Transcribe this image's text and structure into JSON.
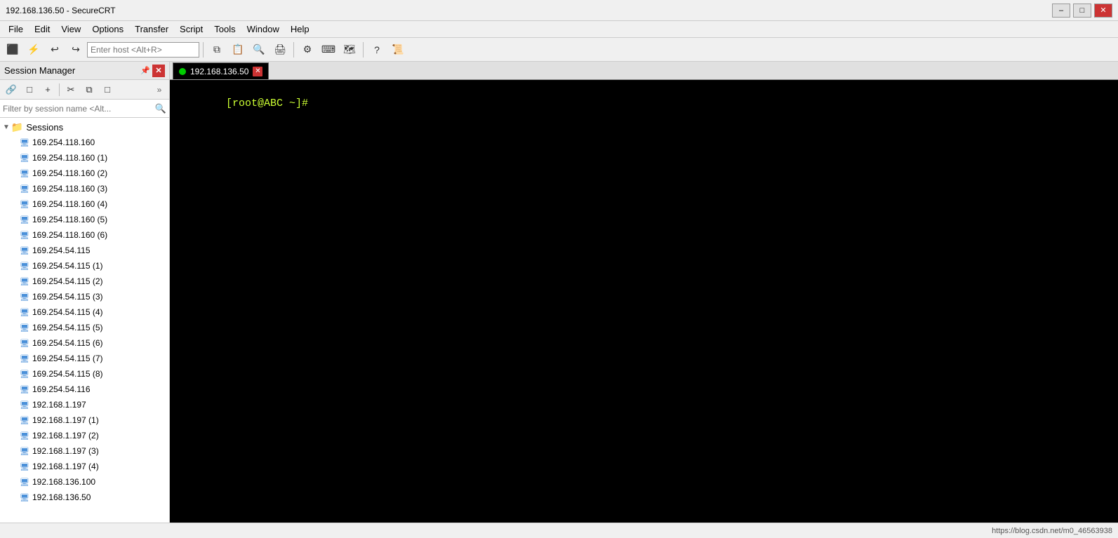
{
  "window": {
    "title": "192.168.136.50 - SecureCRT",
    "minimize_label": "–",
    "maximize_label": "□",
    "close_label": "✕"
  },
  "menu": {
    "items": [
      "File",
      "Edit",
      "View",
      "Options",
      "Transfer",
      "Script",
      "Tools",
      "Window",
      "Help"
    ]
  },
  "toolbar": {
    "host_placeholder": "Enter host <Alt+R>"
  },
  "session_panel": {
    "title": "Session Manager",
    "pin_label": "📌",
    "close_label": "✕",
    "expand_label": "»"
  },
  "session_toolbar": {
    "buttons": [
      "🔗",
      "□",
      "+",
      "✂",
      "⧉",
      "□"
    ]
  },
  "filter": {
    "placeholder": "Filter by session name <Alt..."
  },
  "tree": {
    "root_label": "Sessions",
    "items": [
      "169.254.118.160",
      "169.254.118.160 (1)",
      "169.254.118.160 (2)",
      "169.254.118.160 (3)",
      "169.254.118.160 (4)",
      "169.254.118.160 (5)",
      "169.254.118.160 (6)",
      "169.254.54.115",
      "169.254.54.115 (1)",
      "169.254.54.115 (2)",
      "169.254.54.115 (3)",
      "169.254.54.115 (4)",
      "169.254.54.115 (5)",
      "169.254.54.115 (6)",
      "169.254.54.115 (7)",
      "169.254.54.115 (8)",
      "169.254.54.116",
      "192.168.1.197",
      "192.168.1.197 (1)",
      "192.168.1.197 (2)",
      "192.168.1.197 (3)",
      "192.168.1.197 (4)",
      "192.168.136.100",
      "192.168.136.50"
    ]
  },
  "tab": {
    "label": "192.168.136.50",
    "close_label": "✕"
  },
  "terminal": {
    "prompt": "[root@ABC ~]#"
  },
  "status_bar": {
    "url": "https://blog.csdn.net/m0_46563938"
  }
}
